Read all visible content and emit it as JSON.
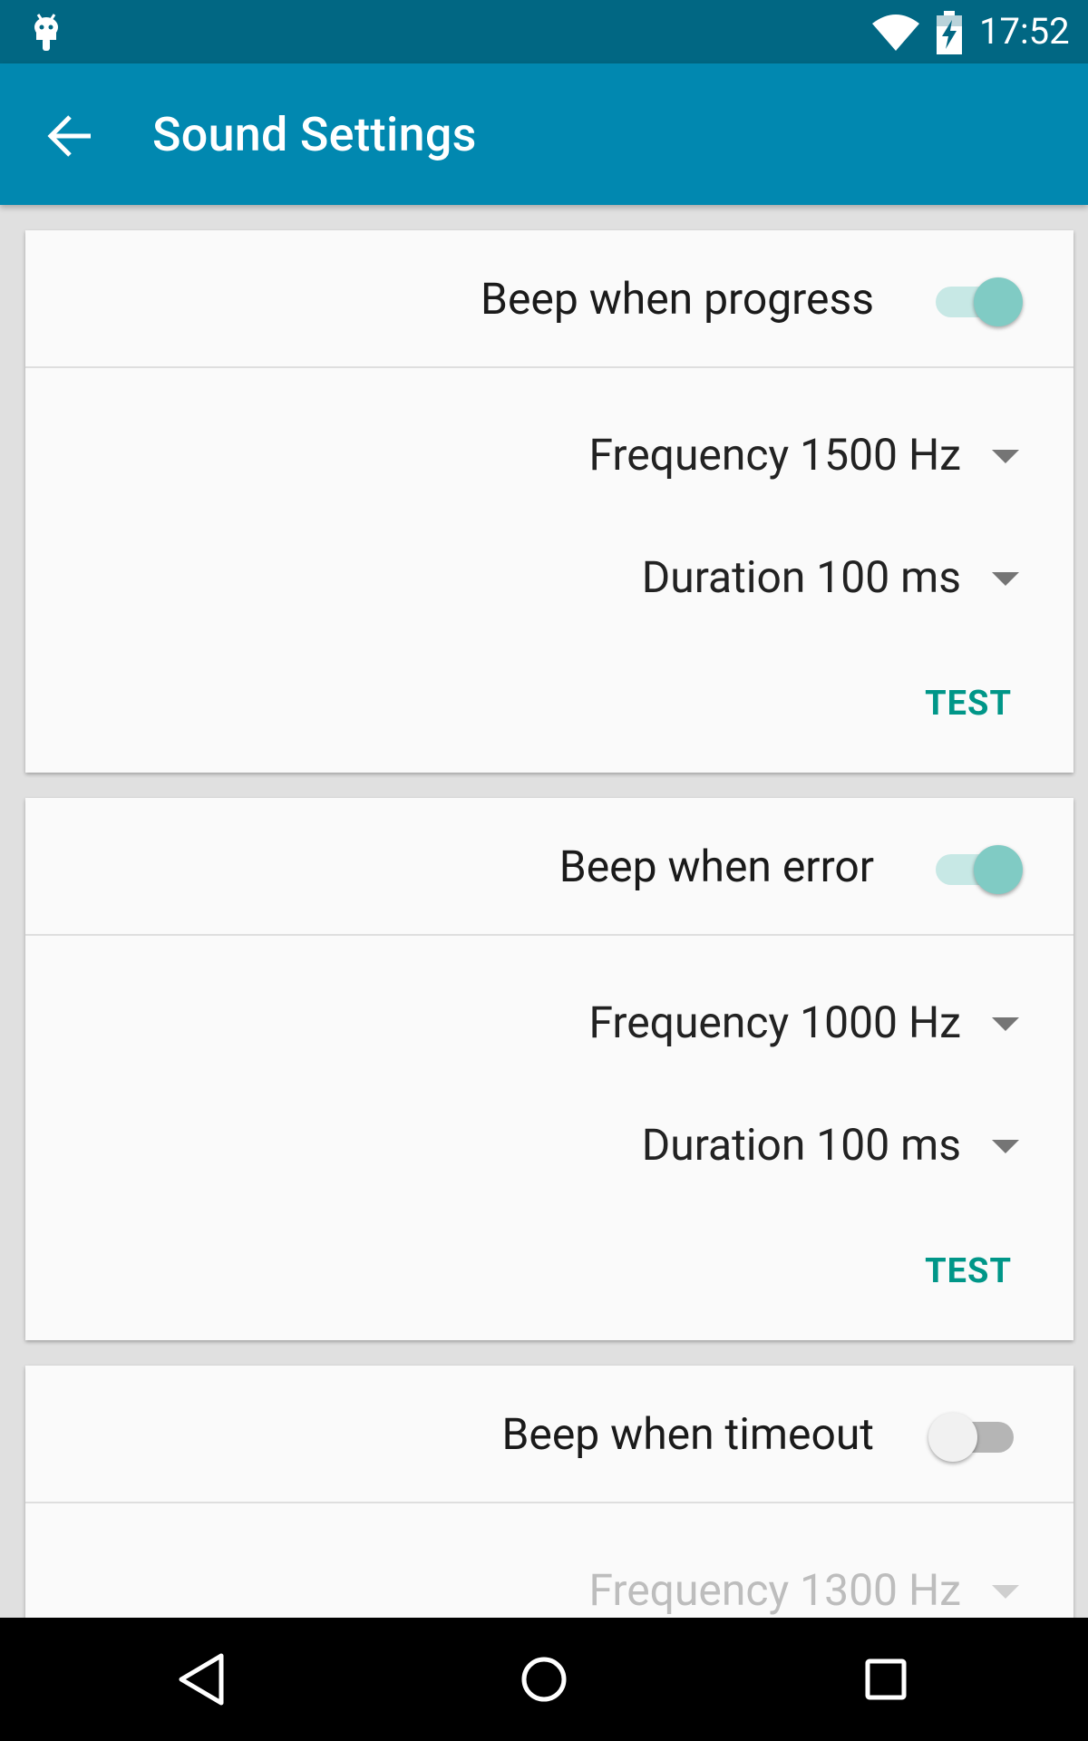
{
  "status_bar": {
    "time": "17:52",
    "icons": [
      "android-icon",
      "wifi-icon",
      "battery-charging-icon"
    ]
  },
  "app_bar": {
    "title": "Sound Settings",
    "back_icon": "arrow-back-icon"
  },
  "cards": [
    {
      "label": "Beep when progress",
      "enabled": true,
      "frequency": "Frequency 1500 Hz",
      "duration": "Duration 100 ms",
      "test_label": "TEST"
    },
    {
      "label": "Beep when error",
      "enabled": true,
      "frequency": "Frequency 1000 Hz",
      "duration": "Duration 100 ms",
      "test_label": "TEST"
    },
    {
      "label": "Beep when timeout",
      "enabled": false,
      "frequency": "Frequency 1300 Hz"
    }
  ],
  "colors": {
    "status_bar": "#016783",
    "app_bar": "#0188b0",
    "accent": "#009688",
    "switch_on_thumb": "#80cbc4"
  },
  "nav_bar": {
    "icons": [
      "nav-back-icon",
      "nav-home-icon",
      "nav-recents-icon"
    ]
  }
}
